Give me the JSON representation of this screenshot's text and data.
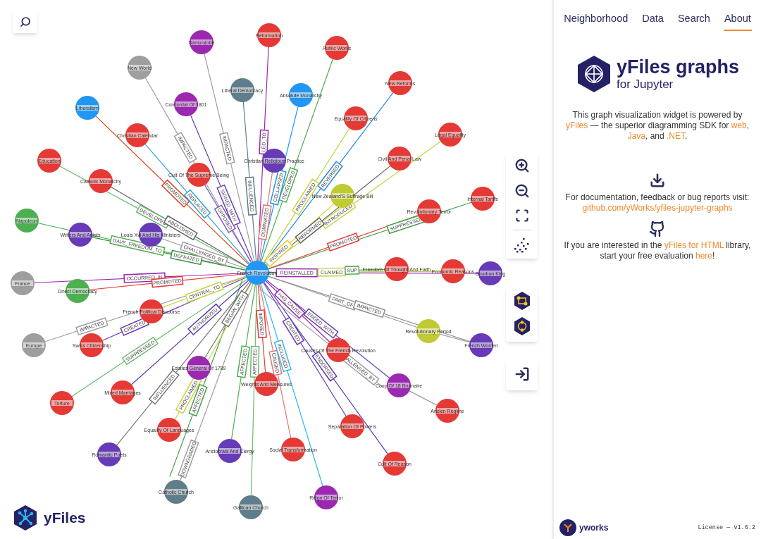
{
  "graph": {
    "nodes": [
      {
        "label": "French Revolution",
        "color": "#2196f3"
      },
      {
        "label": "Sansculotte",
        "color": "#9c27b0"
      },
      {
        "label": "Reformation",
        "color": "#e53935"
      },
      {
        "label": "New World",
        "color": "#9e9e9e"
      },
      {
        "label": "Liberal Democracy",
        "color": "#607d8b"
      },
      {
        "label": "Public Works",
        "color": "#e53935"
      },
      {
        "label": "Absolute Monarchy",
        "color": "#2196f3"
      },
      {
        "label": "Concordat Of 1801",
        "color": "#9c27b0"
      },
      {
        "label": "Liberalism",
        "color": "#2196f3"
      },
      {
        "label": "Christian Calendar",
        "color": "#e53935"
      },
      {
        "label": "Cult Of The Supreme Being",
        "color": "#e53935"
      },
      {
        "label": "Christian Religious Practice",
        "color": "#673ab7"
      },
      {
        "label": "New Reforms",
        "color": "#e53935"
      },
      {
        "label": "Equality Of Citizens",
        "color": "#e53935"
      },
      {
        "label": "Legal Equality",
        "color": "#e53935"
      },
      {
        "label": "Civil And Penal Law",
        "color": "#e53935"
      },
      {
        "label": "New Zealand'S Suffrage Bill",
        "color": "#c0ca33"
      },
      {
        "label": "Education",
        "color": "#e53935"
      },
      {
        "label": "Catholic Monarchy",
        "color": "#e53935"
      },
      {
        "label": "Internal Tariffs",
        "color": "#e53935"
      },
      {
        "label": "Revolutionary Terror",
        "color": "#e53935"
      },
      {
        "label": "Napoleon",
        "color": "#4caf50"
      },
      {
        "label": "Writers And Artists",
        "color": "#673ab7"
      },
      {
        "label": "Louis Xvi And His Ministers",
        "color": "#673ab7"
      },
      {
        "label": "Freedom Of Thought And Faith",
        "color": "#e53935"
      },
      {
        "label": "Economic Reasons",
        "color": "#e53935"
      },
      {
        "label": "Bourbon King",
        "color": "#673ab7"
      },
      {
        "label": "France",
        "color": "#9e9e9e"
      },
      {
        "label": "Direct Democracy",
        "color": "#4caf50"
      },
      {
        "label": "French Political Discourse",
        "color": "#e53935"
      },
      {
        "label": "Revolutionary Period",
        "color": "#c0ca33"
      },
      {
        "label": "Europe",
        "color": "#9e9e9e"
      },
      {
        "label": "Swiss Citizenship",
        "color": "#e53935"
      },
      {
        "label": "French Women",
        "color": "#673ab7"
      },
      {
        "label": "Causes Of The French Revolution",
        "color": "#e53935"
      },
      {
        "label": "Estates General Of 1789",
        "color": "#9c27b0"
      },
      {
        "label": "Weights And Measures",
        "color": "#e53935"
      },
      {
        "label": "Coup Of 18 Brumaire",
        "color": "#9c27b0"
      },
      {
        "label": "Mixed Marriages",
        "color": "#e53935"
      },
      {
        "label": "Torture",
        "color": "#e53935"
      },
      {
        "label": "Ancien Regime",
        "color": "#e53935"
      },
      {
        "label": "Separation Of Powers",
        "color": "#e53935"
      },
      {
        "label": "Equality Of Languages",
        "color": "#e53935"
      },
      {
        "label": "Social Transformation",
        "color": "#e53935"
      },
      {
        "label": "Aristocrats And Clergy",
        "color": "#673ab7"
      },
      {
        "label": "Romantic Poets",
        "color": "#673ab7"
      },
      {
        "label": "Cult Of Reason",
        "color": "#e53935"
      },
      {
        "label": "Catholic Church",
        "color": "#607d8b"
      },
      {
        "label": "Reign Of Terror",
        "color": "#9c27b0"
      },
      {
        "label": "Gallican Church",
        "color": "#607d8b"
      }
    ],
    "edges": [
      {
        "label": "IMPACTED",
        "color": "#9e9e9e"
      },
      {
        "label": "LED_TO",
        "color": "#9c27b0"
      },
      {
        "label": "IMPACTED",
        "color": "#9e9e9e"
      },
      {
        "label": "INFLUENCED",
        "color": "#607d8b"
      },
      {
        "label": "DEVELOPED",
        "color": "#4caf50"
      },
      {
        "label": "COLLAPSED",
        "color": "#2196f3"
      },
      {
        "label": "SIGNED_WITH",
        "color": "#673ab7"
      },
      {
        "label": "PROMOTED",
        "color": "#d84315"
      },
      {
        "label": "REPLACED",
        "color": "#29a3d6"
      },
      {
        "label": "OPPOSED",
        "color": "#7e57c2"
      },
      {
        "label": "DOMINATED",
        "color": "#e57373"
      },
      {
        "label": "REVERSED",
        "color": "#1e88e5"
      },
      {
        "label": "PROCLAIMED",
        "color": "#c6d43f"
      },
      {
        "label": "INTRODUCED",
        "color": "#c6d43f"
      },
      {
        "label": "REFORMED",
        "color": "#616161"
      },
      {
        "label": "INSPIRED",
        "color": "#e8c92a"
      },
      {
        "label": "DEVELOPED",
        "color": "#66bb6a"
      },
      {
        "label": "ABOLISHED",
        "color": "#616161"
      },
      {
        "label": "SUPPRESSED",
        "color": "#43a047"
      },
      {
        "label": "PROMOTED",
        "color": "#e53935"
      },
      {
        "label": "GAVE_FREEDOM_TO",
        "color": "#4caf50"
      },
      {
        "label": "DEFEATED",
        "color": "#388e3c"
      },
      {
        "label": "CHALLENGED_BY",
        "color": "#9e9e9e"
      },
      {
        "label": "REINSTALLED",
        "color": "#9c27b0"
      },
      {
        "label": "CLAIMED",
        "color": "#c6d43f"
      },
      {
        "label": "SUP",
        "color": "#4caf50"
      },
      {
        "label": "OCCURRED_IN",
        "color": "#9c27b0"
      },
      {
        "label": "PROMOTED",
        "color": "#e53935"
      },
      {
        "label": "CENTRAL_TO",
        "color": "#c6d43f"
      },
      {
        "label": "PART_OF",
        "color": "#9e9e9e"
      },
      {
        "label": "IMPACTED",
        "color": "#9e9e9e"
      },
      {
        "label": "CREATED",
        "color": "#673ab7"
      },
      {
        "label": "IMPACTED",
        "color": "#8d8d8d"
      },
      {
        "color": "#9e9e9e"
      },
      {
        "label": "HAS_CAUSE",
        "color": "#9c27b0"
      },
      {
        "label": "BEGAN_WITH",
        "color": "#757575"
      },
      {
        "label": "IMPOSED",
        "color": "#e53935"
      },
      {
        "label": "ENDED_WITH",
        "color": "#673ab7"
      },
      {
        "label": "CHALLENGED_BY",
        "color": "#9e9e9e"
      },
      {
        "label": "AUTHORIZED",
        "color": "#5e35b1"
      },
      {
        "label": "SUPPRESSED",
        "color": "#66bb6a"
      },
      {
        "color": "#9e9e9e"
      },
      {
        "label": "CREATED",
        "color": "#673ab7"
      },
      {
        "label": "PROCLAIMED",
        "color": "#c6d43f"
      },
      {
        "label": "CAUSED",
        "color": "#e57373"
      },
      {
        "label": "AFFECTED",
        "color": "#4caf50"
      },
      {
        "label": "INFLUENCED",
        "color": "#757575"
      },
      {
        "label": "ENDORSED",
        "color": "#5e35b1"
      },
      {
        "label": "DOWNGRADED",
        "color": "#9e9e9e"
      },
      {
        "label": "AFFECTED",
        "color": "#43a047"
      },
      {
        "label": "INCLUDED",
        "color": "#29b6f6"
      },
      {
        "label": "AFFECTED",
        "color": "#66bb6a"
      }
    ]
  },
  "canvas_logo": {
    "text": "yFiles"
  },
  "sidebar": {
    "tabs": [
      {
        "label": "Neighborhood",
        "selected": false
      },
      {
        "label": "Data",
        "selected": false
      },
      {
        "label": "Search",
        "selected": false
      },
      {
        "label": "About",
        "selected": true
      }
    ],
    "logo": {
      "title": "yFiles graphs",
      "subtitle": "for Jupyter"
    },
    "paragraphs": [
      [
        {
          "text": "This graph visualization widget is powered by ",
          "link": false
        },
        {
          "text": "yFiles",
          "link": true
        },
        {
          "text": " — the superior diagramming SDK for ",
          "link": false
        },
        {
          "text": "web",
          "link": true
        },
        {
          "text": ", ",
          "link": false
        },
        {
          "text": "Java",
          "link": true
        },
        {
          "text": ", and ",
          "link": false
        },
        {
          "text": ".NET",
          "link": true
        },
        {
          "text": ".",
          "link": false
        }
      ],
      [
        {
          "text": "For documentation, feedback or bug reports visit: ",
          "link": false
        },
        {
          "text": "github.com/yWorks/yfiles-jupyter-graphs",
          "link": true
        }
      ],
      [
        {
          "text": "If you are interested in the ",
          "link": false
        },
        {
          "text": "yFiles for HTML",
          "link": true
        },
        {
          "text": " library, start your free evaluation ",
          "link": false
        },
        {
          "text": "here",
          "link": true
        },
        {
          "text": "!",
          "link": false
        }
      ]
    ],
    "footer": {
      "brand": "yworks",
      "license": "License — v1.6.2"
    }
  }
}
